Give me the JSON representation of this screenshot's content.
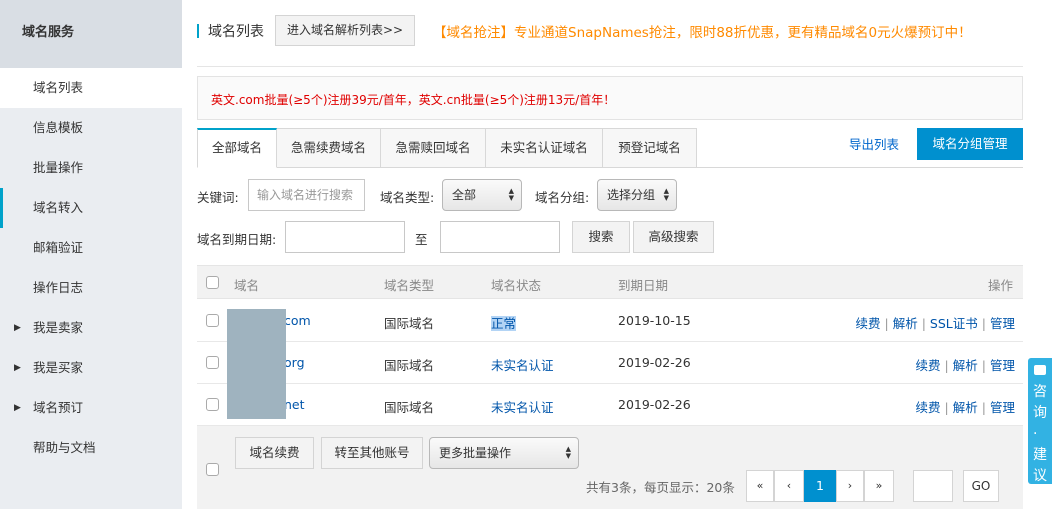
{
  "sidebar": {
    "title": "域名服务",
    "items": [
      {
        "label": "域名列表",
        "active": true,
        "expandable": false
      },
      {
        "label": "信息模板",
        "active": false,
        "expandable": false
      },
      {
        "label": "批量操作",
        "active": false,
        "expandable": false
      },
      {
        "label": "域名转入",
        "active": false,
        "expandable": false
      },
      {
        "label": "邮箱验证",
        "active": false,
        "expandable": false
      },
      {
        "label": "操作日志",
        "active": false,
        "expandable": false
      },
      {
        "label": "我是卖家",
        "active": false,
        "expandable": true
      },
      {
        "label": "我是买家",
        "active": false,
        "expandable": true
      },
      {
        "label": "域名预订",
        "active": false,
        "expandable": true
      },
      {
        "label": "帮助与文档",
        "active": false,
        "expandable": false
      }
    ]
  },
  "header": {
    "title": "域名列表",
    "dns_button": "进入域名解析列表>>",
    "promo": "【域名抢注】专业通道SnapNames抢注，限时88折优惠，更有精品域名0元火爆预订中！"
  },
  "notice": "英文.com批量(≥5个)注册39元/首年，英文.cn批量(≥5个)注册13元/首年！",
  "tabs": [
    "全部域名",
    "急需续费域名",
    "急需赎回域名",
    "未实名认证域名",
    "预登记域名"
  ],
  "toolbar": {
    "export": "导出列表",
    "group_manage": "域名分组管理"
  },
  "filters": {
    "keyword_label": "关键词:",
    "keyword_placeholder": "输入域名进行搜索",
    "type_label": "域名类型:",
    "type_value": "全部",
    "group_label": "域名分组:",
    "group_value": "选择分组",
    "expire_label": "域名到期日期:",
    "to_label": "至",
    "search": "搜索",
    "advanced": "高级搜索"
  },
  "table": {
    "columns": [
      "域名",
      "域名类型",
      "域名状态",
      "到期日期",
      "操作"
    ],
    "rows": [
      {
        "domain": "com",
        "type": "国际域名",
        "status": "正常",
        "expire": "2019-10-15",
        "ops": [
          "续费",
          "解析",
          "SSL证书",
          "管理"
        ]
      },
      {
        "domain": "org",
        "type": "国际域名",
        "status": "未实名认证",
        "expire": "2019-02-26",
        "ops": [
          "续费",
          "解析",
          "管理"
        ]
      },
      {
        "domain": "net",
        "type": "国际域名",
        "status": "未实名认证",
        "expire": "2019-02-26",
        "ops": [
          "续费",
          "解析",
          "管理"
        ]
      }
    ]
  },
  "footer": {
    "renew": "域名续费",
    "transfer": "转至其他账号",
    "more_ops": "更多批量操作",
    "summary": "共有3条，每页显示：20条",
    "pager": {
      "first": "«",
      "prev": "‹",
      "current": "1",
      "next": "›",
      "last": "»"
    },
    "go": "GO"
  },
  "float_btn": {
    "label": [
      "咨",
      "询",
      "·",
      "建",
      "议"
    ]
  },
  "colors": {
    "accent": "#0090cf",
    "promo": "#ff8a00",
    "notice": "#e00000",
    "link": "#0055aa"
  }
}
